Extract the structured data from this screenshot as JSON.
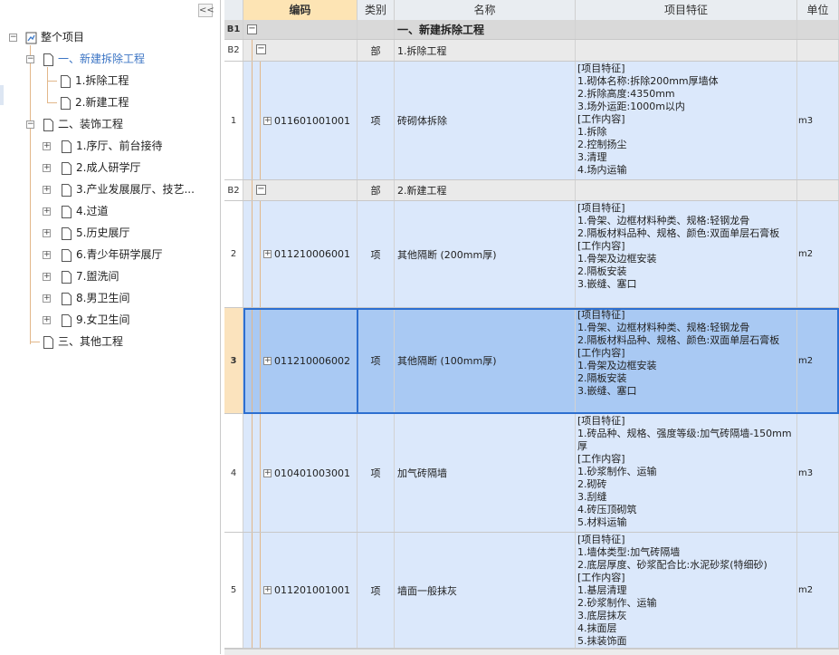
{
  "tree": {
    "collapse_label": "<<",
    "root": "整个项目",
    "nodes": [
      {
        "label": "一、新建拆除工程"
      },
      {
        "label": "1.拆除工程"
      },
      {
        "label": "2.新建工程"
      },
      {
        "label": "二、装饰工程"
      },
      {
        "label": "1.序厅、前台接待"
      },
      {
        "label": "2.成人研学厅"
      },
      {
        "label": "3.产业发展展厅、技艺..."
      },
      {
        "label": "4.过道"
      },
      {
        "label": "5.历史展厅"
      },
      {
        "label": "6.青少年研学展厅"
      },
      {
        "label": "7.盥洗间"
      },
      {
        "label": "8.男卫生间"
      },
      {
        "label": "9.女卫生间"
      },
      {
        "label": "三、其他工程"
      }
    ]
  },
  "grid": {
    "headers": {
      "code": "编码",
      "type": "类别",
      "name": "名称",
      "feature": "项目特征",
      "unit": "单位"
    },
    "rows": [
      {
        "num": "B1",
        "type": "",
        "name": "一、新建拆除工程",
        "code": "",
        "feature": [],
        "unit": ""
      },
      {
        "num": "B2",
        "type": "部",
        "name": "1.拆除工程",
        "code": "",
        "feature": [],
        "unit": ""
      },
      {
        "num": "1",
        "type": "项",
        "name": "砖砌体拆除",
        "code": "011601001001",
        "feature": [
          "[项目特征]",
          "1.砌体名称:拆除200mm厚墙体",
          "2.拆除高度:4350mm",
          "3.场外运距:1000m以内",
          "[工作内容]",
          "1.拆除",
          "2.控制扬尘",
          "3.清理",
          "4.场内运输"
        ],
        "unit": "m3"
      },
      {
        "num": "B2",
        "type": "部",
        "name": "2.新建工程",
        "code": "",
        "feature": [],
        "unit": ""
      },
      {
        "num": "2",
        "type": "项",
        "name": "其他隔断 (200mm厚)",
        "code": "011210006001",
        "feature": [
          "[项目特征]",
          "1.骨架、边框材料种类、规格:轻钢龙骨",
          "2.隔板材料品种、规格、颜色:双面单层石膏板",
          "[工作内容]",
          "1.骨架及边框安装",
          "2.隔板安装",
          "3.嵌缝、塞口"
        ],
        "unit": "m2"
      },
      {
        "num": "3",
        "type": "项",
        "name": "其他隔断 (100mm厚)",
        "code": "011210006002",
        "feature": [
          "[项目特征]",
          "1.骨架、边框材料种类、规格:轻钢龙骨",
          "2.隔板材料品种、规格、颜色:双面单层石膏板",
          "[工作内容]",
          "1.骨架及边框安装",
          "2.隔板安装",
          "3.嵌缝、塞口"
        ],
        "unit": "m2"
      },
      {
        "num": "4",
        "type": "项",
        "name": "加气砖隔墙",
        "code": "010401003001",
        "feature": [
          "[项目特征]",
          "1.砖品种、规格、强度等级:加气砖隔墙-150mm厚",
          "[工作内容]",
          "1.砂浆制作、运输",
          "2.砌砖",
          "3.刮缝",
          "4.砖压顶砌筑",
          "5.材料运输"
        ],
        "unit": "m3"
      },
      {
        "num": "5",
        "type": "项",
        "name": "墙面一般抹灰",
        "code": "011201001001",
        "feature": [
          "[项目特征]",
          "1.墙体类型:加气砖隔墙",
          "2.底层厚度、砂浆配合比:水泥砂浆(特细砂)",
          "[工作内容]",
          "1.基层清理",
          "2.砂浆制作、运输",
          "3.底层抹灰",
          "4.抹面层",
          "5.抹装饰面"
        ],
        "unit": "m2"
      }
    ]
  }
}
